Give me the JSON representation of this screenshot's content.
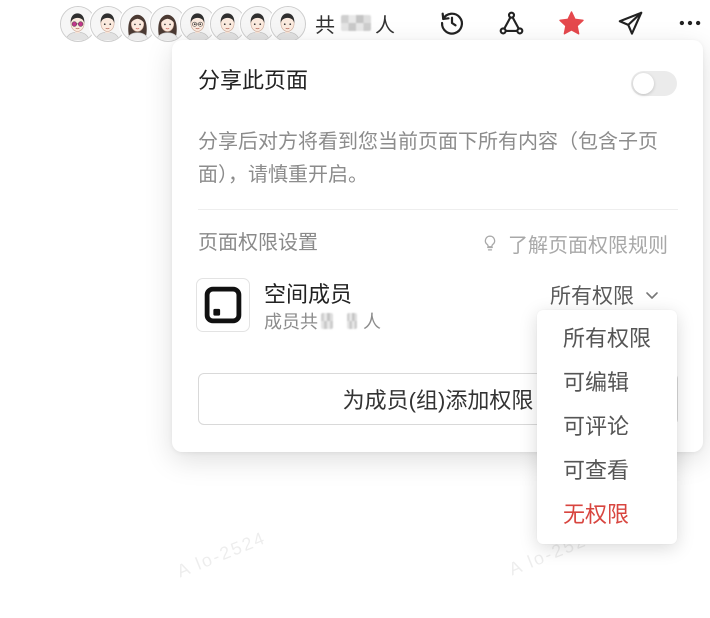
{
  "colors": {
    "star": "#e5484d",
    "danger": "#d8453f",
    "toggle_track_off": "#ebebeb"
  },
  "header": {
    "member_count_prefix": "共",
    "member_count_suffix": "人",
    "actions": [
      {
        "icon": "history-icon"
      },
      {
        "icon": "share-network-icon"
      },
      {
        "icon": "star-icon",
        "active": true
      },
      {
        "icon": "send-icon"
      },
      {
        "icon": "more-icon"
      }
    ]
  },
  "share_panel": {
    "title": "分享此页面",
    "share_enabled": false,
    "description": "分享后对方将看到您当前页面下所有内容（包含子页面），请慎重开启。",
    "permission_section": {
      "label": "页面权限设置",
      "help_icon": "lightbulb-icon",
      "help_link": "了解页面权限规则"
    },
    "members": [
      {
        "icon": "space-icon",
        "name": "空间成员",
        "count_prefix": "成员共",
        "count_suffix": "人",
        "permission": "所有权限"
      }
    ],
    "add_button": "为成员(组)添加权限"
  },
  "permission_menu": {
    "open": true,
    "options": [
      {
        "label": "所有权限"
      },
      {
        "label": "可编辑"
      },
      {
        "label": "可评论"
      },
      {
        "label": "可查看"
      },
      {
        "label": "无权限",
        "danger": true
      }
    ]
  },
  "watermark": {
    "text": "A lo-2524"
  }
}
